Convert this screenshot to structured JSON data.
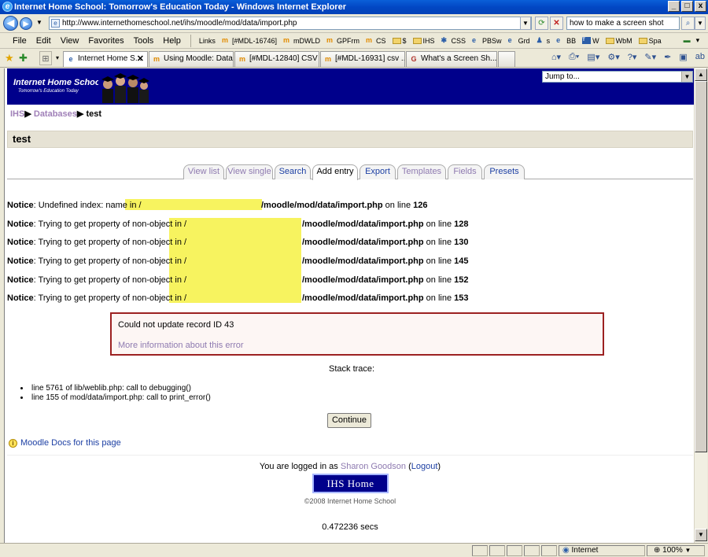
{
  "window": {
    "title": "Internet Home School: Tomorrow's Education Today - Windows Internet Explorer",
    "min": "_",
    "max": "□",
    "close": "x"
  },
  "address": {
    "url": "http://www.internethomeschool.net/ihs/moodle/mod/data/import.php",
    "search_value": "how to make a screen shot"
  },
  "menu": {
    "items": [
      "File",
      "Edit",
      "View",
      "Favorites",
      "Tools",
      "Help"
    ],
    "links_label": "Links",
    "links": [
      "[#MDL-16746]",
      "mDWLD",
      "GPFrm",
      "CS",
      "$",
      "IHS",
      "CSS",
      "PBSw",
      "Grd",
      "s",
      "BB",
      "W",
      "WbM",
      "Spa"
    ]
  },
  "browser_tabs": [
    {
      "label": "Internet Home S...",
      "active": true
    },
    {
      "label": "Using Moodle: Data...",
      "active": false
    },
    {
      "label": "[#MDL-12840] CSV ...",
      "active": false
    },
    {
      "label": "[#MDL-16931] csv ...",
      "active": false
    },
    {
      "label": "What's a Screen Sh...",
      "active": false
    }
  ],
  "site": {
    "logo_title": "Internet Home School",
    "logo_tagline": "Tomorrow's Education Today",
    "jump_to": "Jump to..."
  },
  "breadcrumb": {
    "root": "IHS",
    "databases": "Databases",
    "current": "test",
    "sep": "▶"
  },
  "page_title": "test",
  "module_tabs": [
    "View list",
    "View single",
    "Search",
    "Add entry",
    "Export",
    "Templates",
    "Fields",
    "Presets"
  ],
  "notices": [
    {
      "label": "Notice",
      "msg": ": Undefined index: name in /",
      "path": "/moodle/mod/data/import.php",
      "online": " on line ",
      "line": "126"
    },
    {
      "label": "Notice",
      "msg": ": Trying to get property of non-object in /",
      "path": "/moodle/mod/data/import.php",
      "online": " on line ",
      "line": "128"
    },
    {
      "label": "Notice",
      "msg": ": Trying to get property of non-object in /",
      "path": "/moodle/mod/data/import.php",
      "online": " on line ",
      "line": "130"
    },
    {
      "label": "Notice",
      "msg": ": Trying to get property of non-object in /",
      "path": "/moodle/mod/data/import.php",
      "online": " on line ",
      "line": "145"
    },
    {
      "label": "Notice",
      "msg": ": Trying to get property of non-object in /",
      "path": "/moodle/mod/data/import.php",
      "online": " on line ",
      "line": "152"
    },
    {
      "label": "Notice",
      "msg": ": Trying to get property of non-object in /",
      "path": "/moodle/mod/data/import.php",
      "online": " on line ",
      "line": "153"
    }
  ],
  "error": {
    "message": "Could not update record ID 43",
    "more_info": "More information about this error"
  },
  "stack": {
    "title": "Stack trace:",
    "lines": [
      "line 5761 of lib/weblib.php: call to debugging()",
      "line 155 of mod/data/import.php: call to print_error()"
    ]
  },
  "continue_label": "Continue",
  "docs_label": "Moodle Docs for this page",
  "footer": {
    "logged_in_prefix": "You are logged in as ",
    "user": "Sharon Goodson",
    "logout": "Logout",
    "home_button": "IHS Home",
    "copyright": "©2008 Internet Home School",
    "timing": "0.472236 secs"
  },
  "status": {
    "zone": "Internet",
    "zoom": "100%"
  },
  "colors": {
    "header_bg": "#00008b",
    "link": "#1c3fa3",
    "visited_link": "#8e7ab0",
    "error_border": "#9c2121",
    "redaction": "#f7f35f"
  }
}
